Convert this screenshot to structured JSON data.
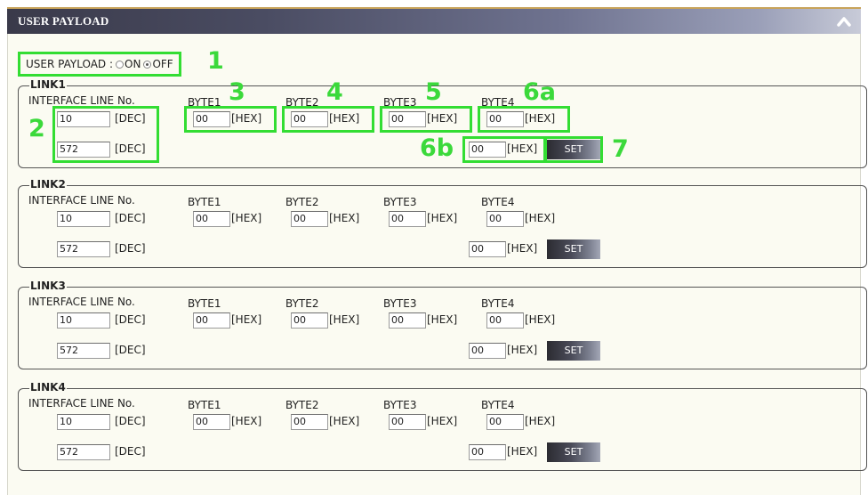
{
  "header": {
    "title": "USER PAYLOAD",
    "collapse_icon": "chevron-up-icon"
  },
  "payload": {
    "label": "USER PAYLOAD :",
    "on_label": "ON",
    "off_label": "OFF",
    "selected": "OFF"
  },
  "common": {
    "interface_label": "INTERFACE LINE No.",
    "dec_unit": "[DEC]",
    "hex_unit": "[HEX]",
    "byte_labels": [
      "BYTE1",
      "BYTE2",
      "BYTE3",
      "BYTE4"
    ],
    "set_label": "SET"
  },
  "links": [
    {
      "name": "LINK1",
      "line1": "10",
      "line2": "572",
      "bytes": [
        "00",
        "00",
        "00",
        "00"
      ],
      "byte4b": "00"
    },
    {
      "name": "LINK2",
      "line1": "10",
      "line2": "572",
      "bytes": [
        "00",
        "00",
        "00",
        "00"
      ],
      "byte4b": "00"
    },
    {
      "name": "LINK3",
      "line1": "10",
      "line2": "572",
      "bytes": [
        "00",
        "00",
        "00",
        "00"
      ],
      "byte4b": "00"
    },
    {
      "name": "LINK4",
      "line1": "10",
      "line2": "572",
      "bytes": [
        "00",
        "00",
        "00",
        "00"
      ],
      "byte4b": "00"
    }
  ],
  "callouts": {
    "c1": "1",
    "c2": "2",
    "c3": "3",
    "c4": "4",
    "c5": "5",
    "c6a": "6a",
    "c6b": "6b",
    "c7": "7"
  },
  "colors": {
    "callout": "#33dd33",
    "panel": "#fbfbf2"
  }
}
